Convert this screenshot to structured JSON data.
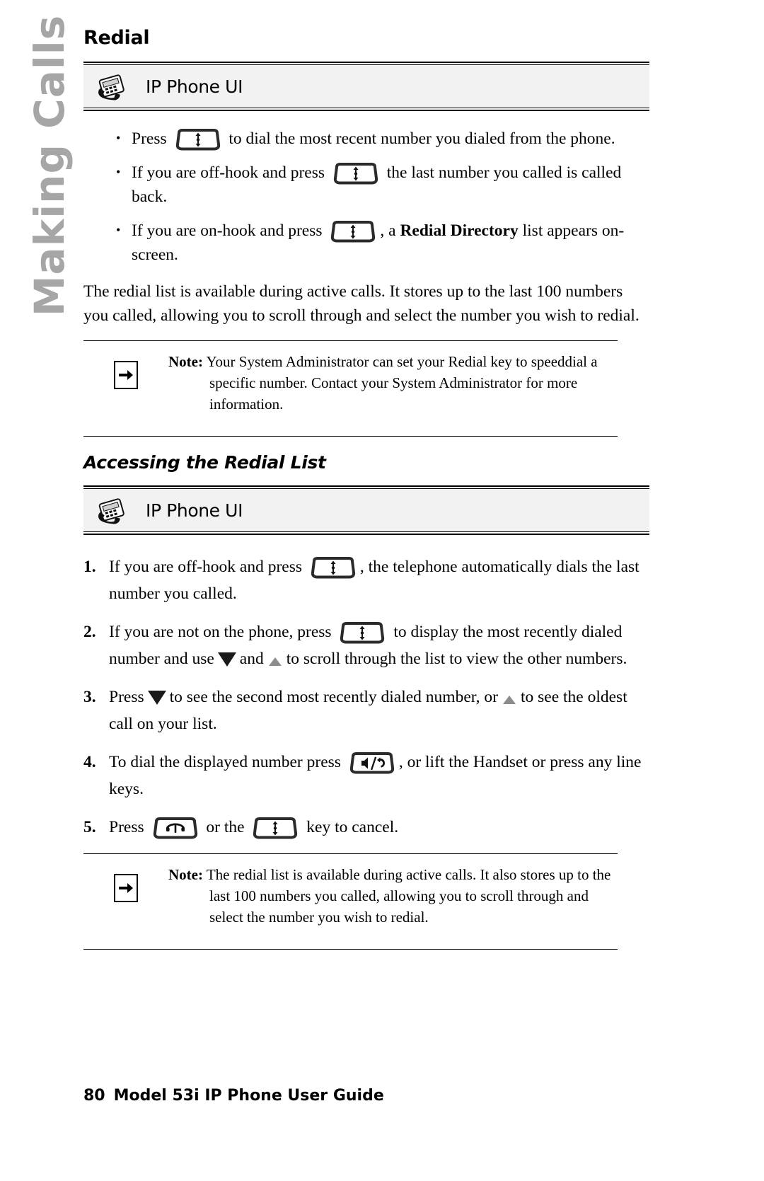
{
  "side_tab": {
    "label": "Making Calls"
  },
  "page": {
    "title": "Redial",
    "subsection_title": "Accessing the Redial List"
  },
  "ui_band": {
    "label": "IP Phone UI",
    "icon": "ip-phone-icon"
  },
  "bullets": [
    {
      "pre": "Press",
      "key": "redial-key",
      "post": "to dial the most recent number you dialed from the phone."
    },
    {
      "pre": "If you are off-hook and press",
      "key": "redial-key",
      "post": "the last number you called is called back."
    },
    {
      "pre": "If you are on-hook and press",
      "key": "redial-key",
      "mid": ", a ",
      "bold": "Redial Directory",
      "post": " list appears on-screen."
    }
  ],
  "paragraph": "The redial list is available during active calls. It stores up to the last 100 numbers you called, allowing you to scroll through and select the number you wish to redial.",
  "note1": {
    "label": "Note:",
    "text": "Your System Administrator can set your Redial key to speeddial a specific number. Contact your System Administrator for more information.",
    "icon": "arrow-right-icon"
  },
  "steps": [
    {
      "number": "1.",
      "pre": "If you are off-hook and press",
      "key": "redial-key",
      "post": ", the telephone automatically dials the last number you called."
    },
    {
      "number": "2.",
      "pre": "If you are not on the phone, press",
      "key": "redial-key",
      "mid": "to display the most recently dialed number and use",
      "arrow1": "down-arrow-icon",
      "between": "and",
      "arrow2": "up-arrow-icon",
      "post": "to scroll through the list to view the other numbers."
    },
    {
      "number": "3.",
      "pre": "Press",
      "arrow1": "down-arrow-icon",
      "mid": "to see the second most recently dialed number, or",
      "arrow2": "up-arrow-icon",
      "post": "to see the oldest call on your list."
    },
    {
      "number": "4.",
      "pre": "To dial the displayed number press",
      "key": "speaker-headset-key",
      "post": ", or lift the Handset or press any line keys."
    },
    {
      "number": "5.",
      "pre": "Press",
      "key": "goodbye-key",
      "mid": "or the",
      "key2": "redial-key",
      "post": "key to cancel."
    }
  ],
  "note2": {
    "label": "Note:",
    "text": "The redial list is available during active calls. It also stores up to the last 100 numbers you called, allowing you to scroll through and select the number you wish to redial.",
    "icon": "arrow-right-icon"
  },
  "footer": {
    "page_number": "80",
    "guide_title": "Model 53i IP Phone User Guide"
  },
  "colors": {
    "side_tab": "#a6a6a6",
    "band_fill": "#f2f2f2",
    "rule": "#000000",
    "arrow_down": "#1a1a1a",
    "arrow_up": "#8c8c8c"
  }
}
